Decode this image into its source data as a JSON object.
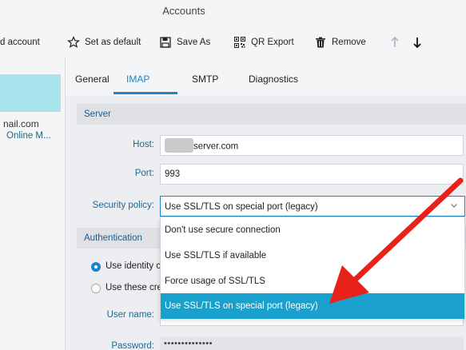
{
  "window": {
    "title": "Accounts"
  },
  "toolbar": {
    "add_label": "d account",
    "set_default_label": "Set as default",
    "save_as_label": "Save As",
    "qr_export_label": "QR Export",
    "remove_label": "Remove"
  },
  "accounts": {
    "email": "nail.com",
    "subtitle": "Online M..."
  },
  "tabs": [
    {
      "label": "General"
    },
    {
      "label": "IMAP"
    },
    {
      "label": "SMTP"
    },
    {
      "label": "Diagnostics"
    }
  ],
  "server": {
    "section_title": "Server",
    "host_label": "Host:",
    "host_value": "server.com",
    "port_label": "Port:",
    "port_value": "993",
    "security_label": "Security policy:",
    "security_value": "Use SSL/TLS on special port (legacy)",
    "security_options": [
      "Don't use secure connection",
      "Use SSL/TLS if available",
      "Force usage of SSL/TLS",
      "Use SSL/TLS on special port (legacy)"
    ]
  },
  "auth": {
    "section_title": "Authentication",
    "radio_1": "Use identity c",
    "radio_2": "Use these cre",
    "user_label": "User name:",
    "password_label": "Password:",
    "password_value": "••••••••••••••"
  },
  "colors": {
    "accent": "#1a86c8",
    "selected_item": "#1aa0cc",
    "account_selected": "#a9e4ec",
    "annotation_arrow": "#e8221b"
  }
}
